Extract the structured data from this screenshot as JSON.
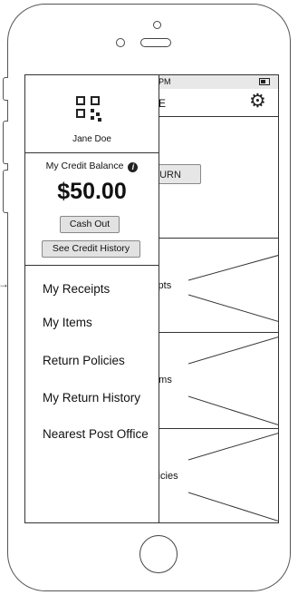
{
  "status": {
    "time": "PM"
  },
  "appbar": {
    "title": "E",
    "settings_icon": "gear-icon"
  },
  "main": {
    "return_button": "ETURN",
    "tiles": [
      {
        "label": "eipts"
      },
      {
        "label": "tems"
      },
      {
        "label": "olicies"
      }
    ]
  },
  "drawer": {
    "qr_icon": "qr-code-icon",
    "user_name": "Jane Doe",
    "credit_label": "My Credit Balance",
    "credit_info_icon": "info-icon",
    "balance": "$50.00",
    "cash_out": "Cash Out",
    "credit_history": "See Credit History",
    "menu": [
      {
        "label": "My Receipts"
      },
      {
        "label": "My Items"
      },
      {
        "label": "Return Policies"
      },
      {
        "label": "My Return History"
      },
      {
        "label": "Nearest Post Office"
      }
    ]
  },
  "colors": {
    "outline": "#333333",
    "button": "#e2e2e2",
    "statusbar": "#e8e8e8"
  }
}
